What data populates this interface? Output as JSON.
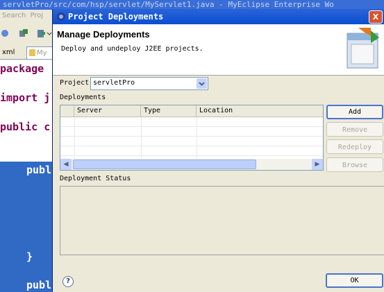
{
  "background_window": {
    "title": "servletPro/src/com/hsp/servlet/MyServlet1.java - MyEclipse Enterprise Wo",
    "menu": [
      "Search",
      "Proj"
    ],
    "tabs": [
      "xml",
      "My"
    ],
    "code_lines": [
      "package",
      "import j",
      "public c",
      "publ",
      "}",
      "publ"
    ]
  },
  "dialog": {
    "title": "Project Deployments",
    "close_label": "X",
    "banner_title": "Manage Deployments",
    "banner_description": "Deploy and undeploy J2EE projects.",
    "project_label": "Project",
    "project_value": "servletPro",
    "deployments_label": "Deployments",
    "table_headers": [
      "Server",
      "Type",
      "Location"
    ],
    "table_rows": [],
    "buttons": {
      "add": "Add",
      "remove": "Remove",
      "redeploy": "Redeploy",
      "browse": "Browse"
    },
    "status_label": "Deployment Status",
    "help_label": "?",
    "ok_label": "OK"
  },
  "colors": {
    "title_bar": "#0a4fd0",
    "selection": "#316ac5",
    "keyword": "#7f0055"
  }
}
